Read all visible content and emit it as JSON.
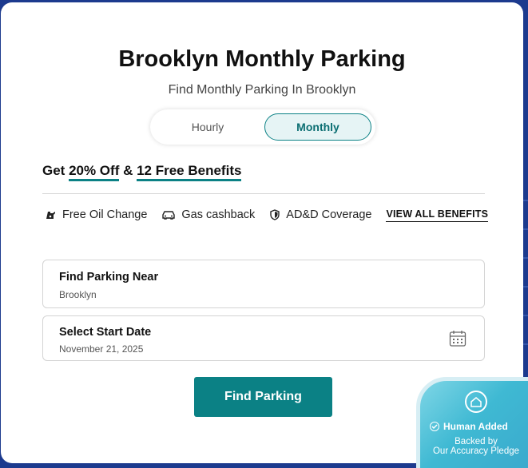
{
  "page": {
    "title": "Brooklyn Monthly Parking",
    "subtitle": "Find Monthly Parking In Brooklyn"
  },
  "toggle": {
    "options": [
      {
        "label": "Hourly",
        "selected": false
      },
      {
        "label": "Monthly",
        "selected": true
      }
    ]
  },
  "promo": {
    "prefix": "Get ",
    "discount": "20% Off",
    "connector": " & ",
    "benefits_count": "12 Free Benefits"
  },
  "benefits": {
    "items": [
      {
        "label": "Free Oil Change",
        "icon": "oil-can-icon"
      },
      {
        "label": "Gas cashback",
        "icon": "car-icon"
      },
      {
        "label": "AD&D Coverage",
        "icon": "shield-icon"
      }
    ],
    "view_all": "VIEW ALL BENEFITS"
  },
  "search": {
    "location_label": "Find Parking Near",
    "location_value": "Brooklyn",
    "date_label": "Select Start Date",
    "date_value": "November 21, 2025",
    "calendar_icon": "calendar-icon",
    "submit_label": "Find Parking"
  },
  "pledge_badge": {
    "icon": "house-icon",
    "title": "Human Added",
    "line1": "Backed by",
    "line2": "Our Accuracy Pledge"
  },
  "colors": {
    "accent": "#0b8185",
    "background": "#1c3a8e",
    "badge": "#3fb9d3"
  }
}
